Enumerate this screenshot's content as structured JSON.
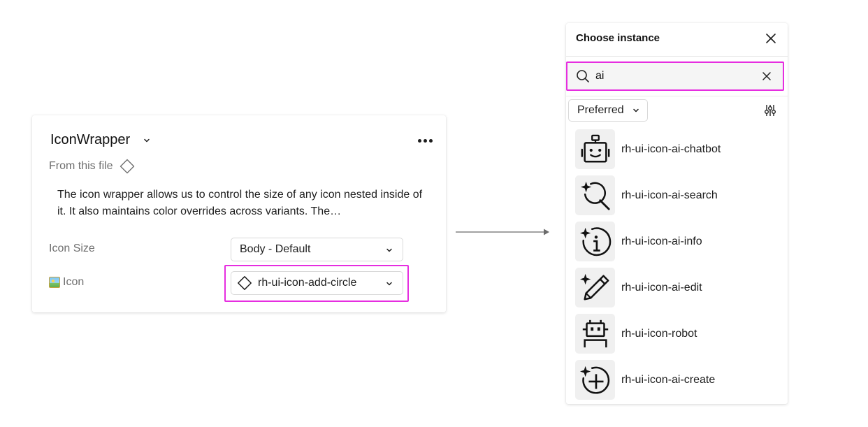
{
  "component": {
    "name": "IconWrapper",
    "source": "From this file",
    "description": "The icon wrapper allows us to control the size of any icon nested inside of it. It also maintains color overrides across variants. The…",
    "properties": [
      {
        "label": "Icon Size",
        "value": "Body - Default"
      },
      {
        "label": "Icon",
        "value": "rh-ui-icon-add-circle"
      }
    ]
  },
  "instance_picker": {
    "title": "Choose instance",
    "search_value": "ai",
    "filter_value": "Preferred",
    "results": [
      {
        "label": "rh-ui-icon-ai-chatbot",
        "icon": "chatbot-icon"
      },
      {
        "label": "rh-ui-icon-ai-search",
        "icon": "ai-search-icon"
      },
      {
        "label": "rh-ui-icon-ai-info",
        "icon": "ai-info-icon"
      },
      {
        "label": "rh-ui-icon-ai-edit",
        "icon": "ai-edit-icon"
      },
      {
        "label": "rh-ui-icon-robot",
        "icon": "robot-icon"
      },
      {
        "label": "rh-ui-icon-ai-create",
        "icon": "ai-create-icon"
      }
    ]
  },
  "colors": {
    "highlight": "#e62ee0",
    "text": "#1e1e1e",
    "muted": "#6f6f6f",
    "thumb_bg": "#f0f0f0"
  }
}
